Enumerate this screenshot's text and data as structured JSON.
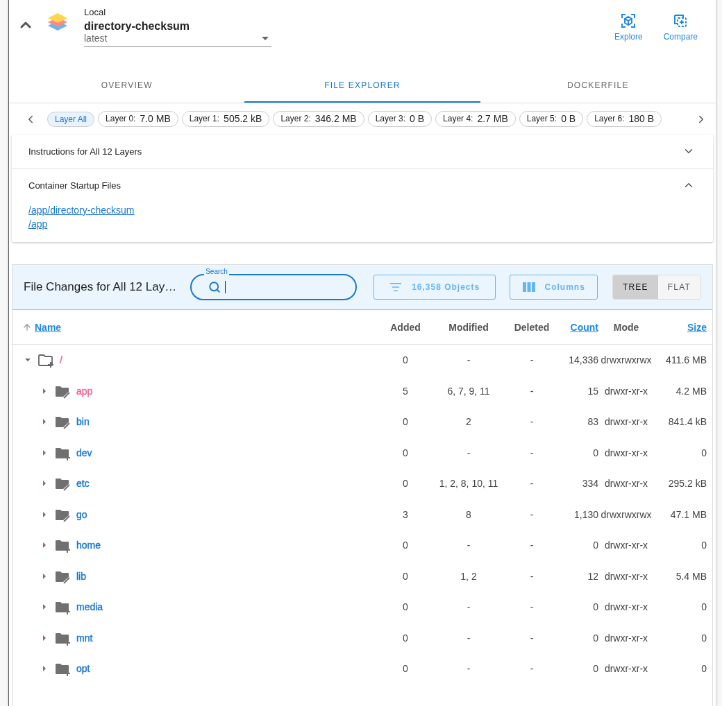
{
  "image": {
    "source": "Local",
    "name": "directory-checksum",
    "tag": "latest"
  },
  "actions": [
    {
      "kind": "explore",
      "label": "Explore"
    },
    {
      "kind": "compare",
      "label": "Compare"
    }
  ],
  "tabs": [
    {
      "label": "OVERVIEW",
      "selected": false
    },
    {
      "label": "FILE EXPLORER",
      "selected": true
    },
    {
      "label": "DOCKERFILE",
      "selected": false
    }
  ],
  "layers": [
    {
      "label": "Layer All",
      "selected": true
    },
    {
      "label": "Layer 0:",
      "size": "7.0 MB",
      "selected": false
    },
    {
      "label": "Layer 1:",
      "size": "505.2 kB",
      "selected": false
    },
    {
      "label": "Layer 2:",
      "size": "346.2 MB",
      "selected": false
    },
    {
      "label": "Layer 3:",
      "size": "0 B",
      "selected": false
    },
    {
      "label": "Layer 4:",
      "size": "2.7 MB",
      "selected": false
    },
    {
      "label": "Layer 5:",
      "size": "0 B",
      "selected": false
    },
    {
      "label": "Layer 6:",
      "size": "180 B",
      "selected": false
    }
  ],
  "sections": [
    {
      "title": "Instructions for All 12 Layers",
      "expanded": false
    },
    {
      "title": "Container Startup Files",
      "expanded": true,
      "links": [
        "/app/directory-checksum",
        "/app"
      ]
    }
  ],
  "file_changes": {
    "title": "File Changes for All 12 Lay…",
    "search": {
      "label": "Search"
    },
    "objects": "16,358 Objects",
    "columns_button": "Columns",
    "views": [
      {
        "label": "TREE",
        "selected": true
      },
      {
        "label": "FLAT",
        "selected": false
      }
    ],
    "columns": [
      {
        "label": "Name",
        "sortable": true,
        "sorted": true
      },
      {
        "label": "Added",
        "sortable": false,
        "sorted": false
      },
      {
        "label": "Modified",
        "sortable": false,
        "sorted": false
      },
      {
        "label": "Deleted",
        "sortable": false,
        "sorted": false
      },
      {
        "label": "Count",
        "sortable": true,
        "sorted": false
      },
      {
        "label": "Mode",
        "sortable": false,
        "sorted": false
      },
      {
        "label": "Size",
        "sortable": true,
        "sorted": false
      }
    ],
    "tree": [
      {
        "name": "/",
        "kind": "outline-added",
        "color": "#f06292",
        "expanded": true,
        "added": "0",
        "modified": "-",
        "deleted": "-",
        "count": "14,336",
        "mode": "drwxrwxrwx",
        "size": "411.6 MB",
        "children": [
          {
            "name": "app",
            "kind": "modified",
            "color": "#f06292",
            "expanded": false,
            "added": "5",
            "modified": "6, 7, 9, 11",
            "deleted": "-",
            "count": "15",
            "mode": "drwxr-xr-x",
            "size": "4.2 MB"
          },
          {
            "name": "bin",
            "kind": "modified",
            "color": "#1976d2",
            "expanded": false,
            "added": "0",
            "modified": "2",
            "deleted": "-",
            "count": "83",
            "mode": "drwxr-xr-x",
            "size": "841.4 kB"
          },
          {
            "name": "dev",
            "kind": "added",
            "color": "#1976d2",
            "expanded": false,
            "added": "0",
            "modified": "-",
            "deleted": "-",
            "count": "0",
            "mode": "drwxr-xr-x",
            "size": "0"
          },
          {
            "name": "etc",
            "kind": "modified",
            "color": "#1976d2",
            "expanded": false,
            "added": "0",
            "modified": "1, 2, 8, 10, 11",
            "deleted": "-",
            "count": "334",
            "mode": "drwxr-xr-x",
            "size": "295.2 kB"
          },
          {
            "name": "go",
            "kind": "modified",
            "color": "#1976d2",
            "expanded": false,
            "added": "3",
            "modified": "8",
            "deleted": "-",
            "count": "1,130",
            "mode": "drwxrwxrwx",
            "size": "47.1 MB"
          },
          {
            "name": "home",
            "kind": "added",
            "color": "#1976d2",
            "expanded": false,
            "added": "0",
            "modified": "-",
            "deleted": "-",
            "count": "0",
            "mode": "drwxr-xr-x",
            "size": "0"
          },
          {
            "name": "lib",
            "kind": "modified",
            "color": "#1976d2",
            "expanded": false,
            "added": "0",
            "modified": "1, 2",
            "deleted": "-",
            "count": "12",
            "mode": "drwxr-xr-x",
            "size": "5.4 MB"
          },
          {
            "name": "media",
            "kind": "added",
            "color": "#1976d2",
            "expanded": false,
            "added": "0",
            "modified": "-",
            "deleted": "-",
            "count": "0",
            "mode": "drwxr-xr-x",
            "size": "0"
          },
          {
            "name": "mnt",
            "kind": "added",
            "color": "#1976d2",
            "expanded": false,
            "added": "0",
            "modified": "-",
            "deleted": "-",
            "count": "0",
            "mode": "drwxr-xr-x",
            "size": "0"
          },
          {
            "name": "opt",
            "kind": "added",
            "color": "#1976d2",
            "expanded": false,
            "added": "0",
            "modified": "-",
            "deleted": "-",
            "count": "0",
            "mode": "drwxr-xr-x",
            "size": "0"
          }
        ]
      }
    ]
  }
}
